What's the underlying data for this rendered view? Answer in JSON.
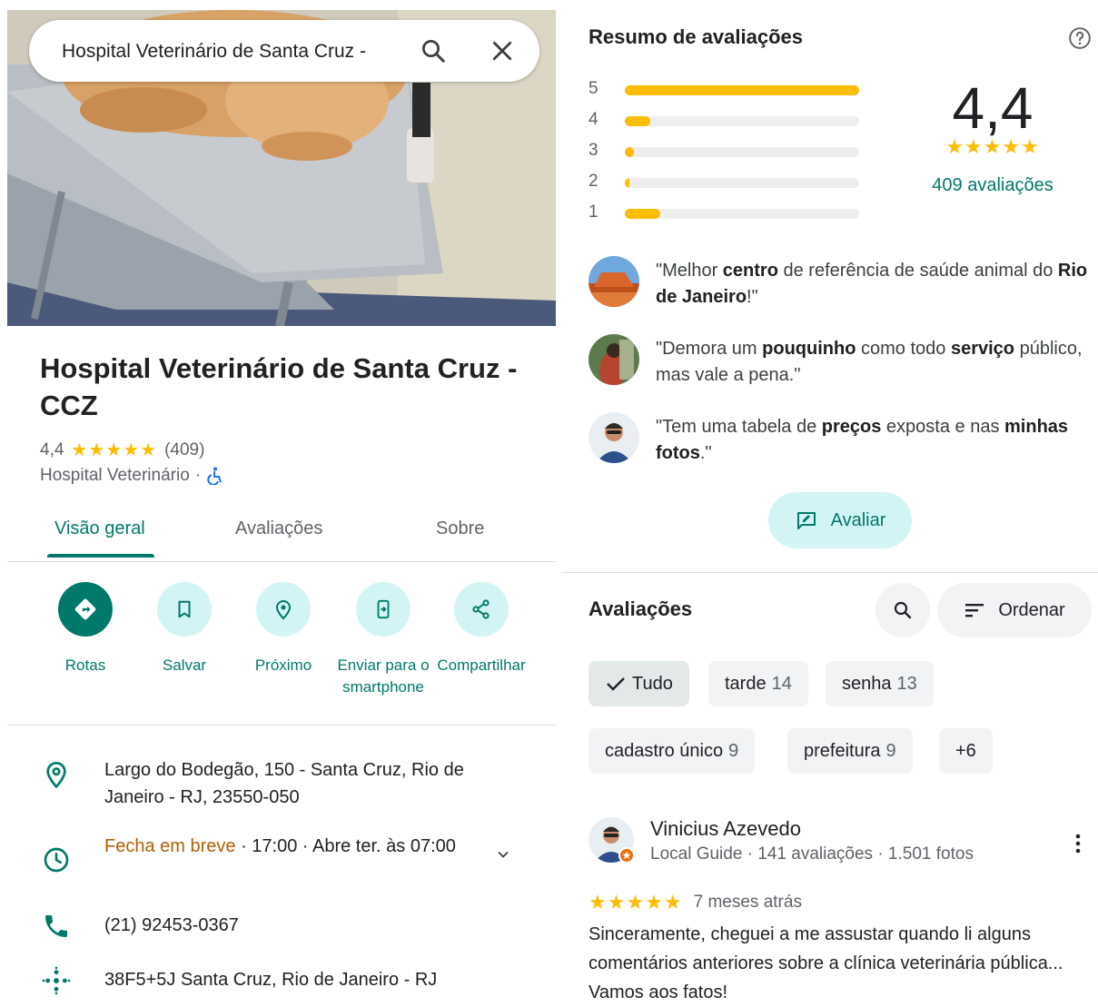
{
  "search": {
    "query": "Hospital Veterinário de Santa Cruz -"
  },
  "place": {
    "title": "Hospital Veterinário de Santa Cruz - CCZ",
    "rating": "4,4",
    "stars": "★★★★★",
    "review_count": "(409)",
    "category": "Hospital Veterinário",
    "separator": "·"
  },
  "tabs": [
    {
      "label": "Visão geral",
      "active": true
    },
    {
      "label": "Avaliações",
      "active": false
    },
    {
      "label": "Sobre",
      "active": false
    }
  ],
  "actions": [
    {
      "label": "Rotas",
      "icon": "directions-icon"
    },
    {
      "label": "Salvar",
      "icon": "bookmark-icon"
    },
    {
      "label": "Próximo",
      "icon": "nearby-icon"
    },
    {
      "label": "Enviar para o smartphone",
      "icon": "send-to-phone-icon"
    },
    {
      "label": "Compartilhar",
      "icon": "share-icon"
    }
  ],
  "info": {
    "address": "Largo do Bodegão, 150 - Santa Cruz, Rio de Janeiro - RJ, 23550-050",
    "hours_status": "Fecha em breve",
    "hours_detail": " · 17:00 · Abre ter. às 07:00",
    "phone": "(21) 92453-0367",
    "plus_code": "38F5+5J Santa Cruz, Rio de Janeiro - RJ"
  },
  "summary": {
    "title": "Resumo de avaliações",
    "distribution": [
      {
        "stars": "5",
        "fraction": 1.0
      },
      {
        "stars": "4",
        "fraction": 0.11
      },
      {
        "stars": "3",
        "fraction": 0.04
      },
      {
        "stars": "2",
        "fraction": 0.02
      },
      {
        "stars": "1",
        "fraction": 0.15
      }
    ],
    "average": "4,4",
    "stars": "★★★★★",
    "reviews_link": "409 avaliações"
  },
  "quotes": [
    {
      "parts": [
        "\"Melhor ",
        "centro",
        " de referência de saúde animal do ",
        "Rio de Janeiro",
        "!\""
      ]
    },
    {
      "parts": [
        "\"Demora um ",
        "pouquinho",
        " como todo ",
        "serviço",
        " público, mas vale a pena.\""
      ]
    },
    {
      "parts": [
        "\"Tem uma tabela de ",
        "preços",
        " exposta e nas ",
        "minhas fotos",
        ".\""
      ]
    }
  ],
  "rate_button": "Avaliar",
  "reviews": {
    "title": "Avaliações",
    "sort_label": "Ordenar",
    "chips": [
      {
        "label": "Tudo",
        "count": ""
      },
      {
        "label": "tarde",
        "count": "14"
      },
      {
        "label": "senha",
        "count": "13"
      },
      {
        "label": "cadastro único",
        "count": "9"
      },
      {
        "label": "prefeitura",
        "count": "9"
      },
      {
        "label": "+6",
        "count": ""
      }
    ]
  },
  "review": {
    "author": "Vinicius Azevedo",
    "meta": "Local Guide · 141 avaliações · 1.501 fotos",
    "stars": "★★★★★",
    "time": "7 meses atrás",
    "text": "Sinceramente, cheguei a me assustar quando li alguns comentários anteriores sobre a clínica veterinária pública... Vamos aos fatos!"
  },
  "colors": {
    "accent": "#00796b",
    "star": "#fbbc04",
    "chip_bg": "#f1f3f4",
    "action_bg": "#d3f4f4",
    "closing": "#b06000"
  }
}
